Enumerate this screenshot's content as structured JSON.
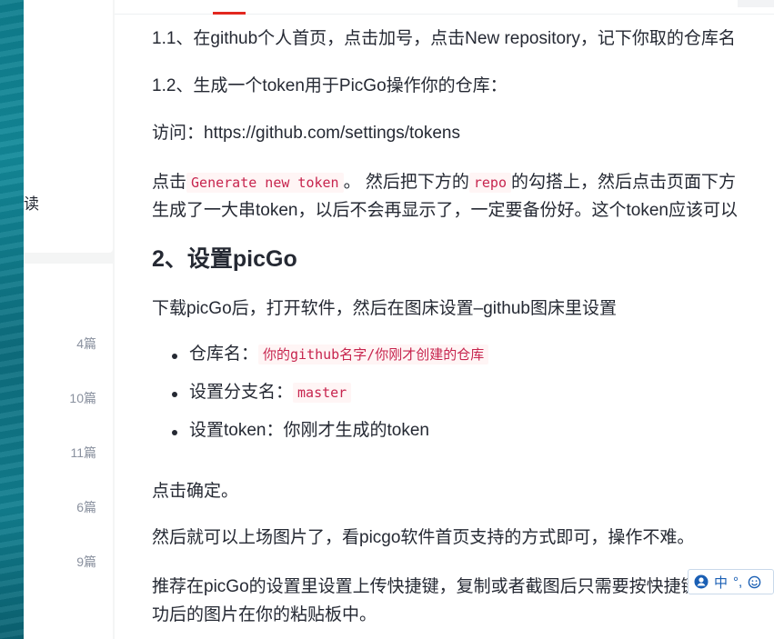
{
  "sidebar": {
    "read_label": "读",
    "counts": [
      "4篇",
      "10篇",
      "11篇",
      "6篇",
      "9篇"
    ]
  },
  "article": {
    "p1": "1.1、在github个人首页，点击加号，点击New repository，记下你取的仓库名",
    "p2": "1.2、生成一个token用于PicGo操作你的仓库：",
    "p3": "访问：https://github.com/settings/tokens",
    "p4_pre": "点击",
    "p4_code1": "Generate new token",
    "p4_mid": "。 然后把下方的",
    "p4_code2": "repo",
    "p4_post": "的勾搭上，然后点击页面下方",
    "p5": "生成了一大串token，以后不会再显示了，一定要备份好。这个token应该可以",
    "h2": "2、设置picGo",
    "p6": "下载picGo后，打开软件，然后在图床设置–github图床里设置",
    "bullets": [
      {
        "label": "仓库名：",
        "code": "你的github名字/你刚才创建的仓库"
      },
      {
        "label": "设置分支名：",
        "code": "master"
      },
      {
        "label": "设置token：你刚才生成的token",
        "code": ""
      }
    ],
    "p7": "点击确定。",
    "p8": "然后就可以上场图片了，看picgo软件首页支持的方式即可，操作不难。",
    "p9": "推荐在picGo的设置里设置上传快捷键，复制或者截图后只需要按快捷键",
    "p10": "功后的图片在你的粘贴板中。"
  },
  "ime": {
    "lang": "中",
    "punct": "°,",
    "icons": [
      "user-icon",
      "smiley-icon"
    ]
  },
  "colors": {
    "accent": "#e2271f",
    "code_text": "#c7254e",
    "code_bg": "#fff5f5",
    "body_text": "#252933",
    "muted": "#8a919f"
  }
}
